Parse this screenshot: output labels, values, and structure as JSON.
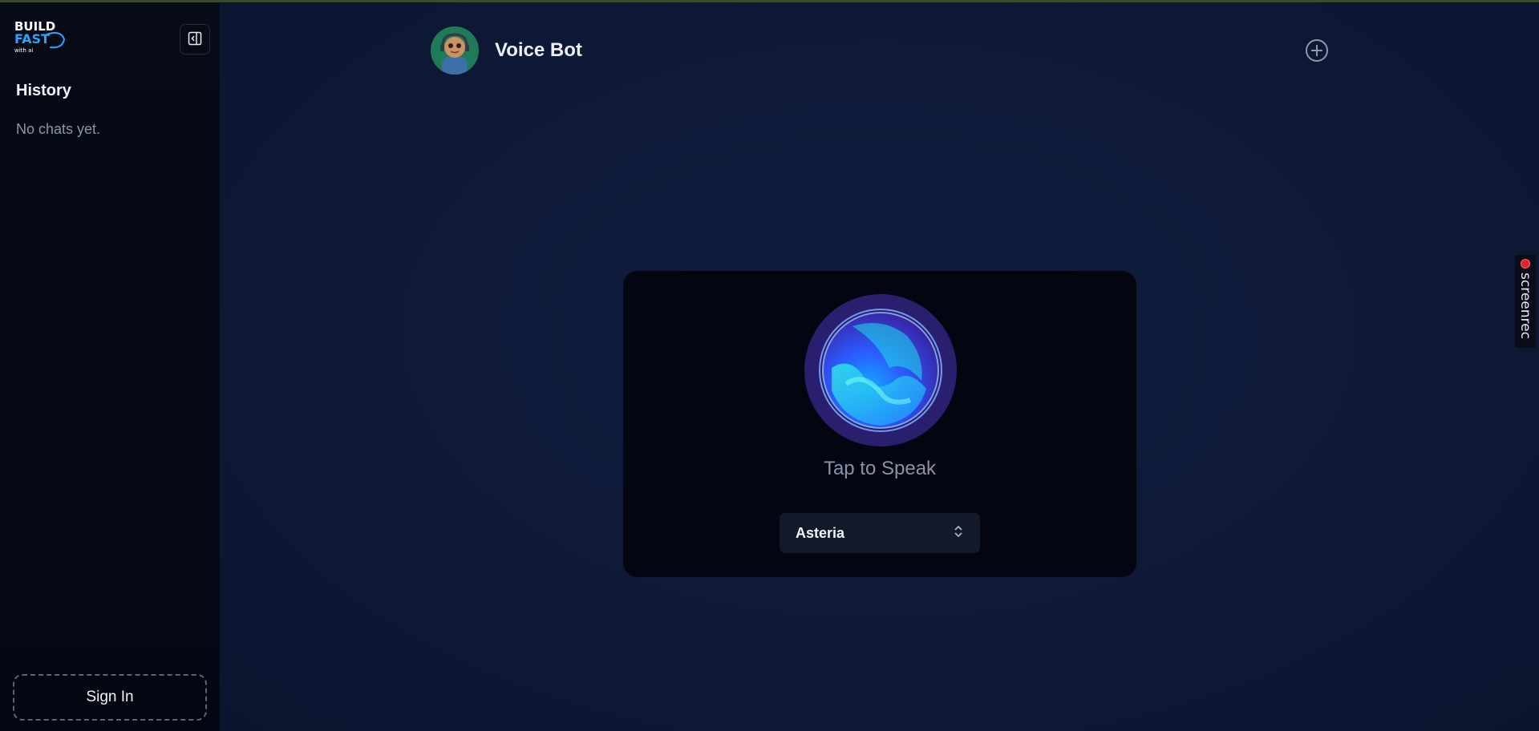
{
  "sidebar": {
    "logo_text": "BUILD FAST with ai",
    "history_title": "History",
    "empty_text": "No chats yet.",
    "sign_in_label": "Sign In"
  },
  "header": {
    "title": "Voice Bot"
  },
  "voice": {
    "tap_label": "Tap to Speak",
    "voice_select_value": "Asteria"
  },
  "overlay": {
    "screenrec_label": "screenrec"
  },
  "colors": {
    "accent": "#2a1f6e",
    "orb_cyan": "#1fe0e8",
    "orb_blue": "#2f63ff",
    "record_red": "#e5202a"
  }
}
